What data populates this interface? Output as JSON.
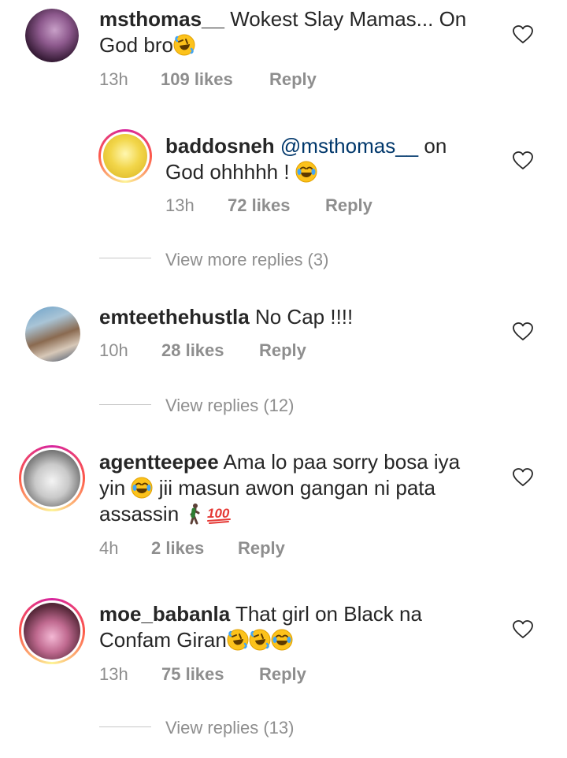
{
  "colors": {
    "text": "#262626",
    "secondary": "#8e8e8e",
    "mention": "#00376b"
  },
  "comments": [
    {
      "username": "msthomas__",
      "text": "Wokest Slay Mamas... On God bro",
      "time": "13h",
      "likes": "109 likes",
      "reply": "Reply",
      "emojis": [
        "rofl-emoji"
      ]
    },
    {
      "username": "baddosneh",
      "mention": "@msthomas__",
      "text_a": " on",
      "text_b": "God ohhhhh ! ",
      "time": "13h",
      "likes": "72 likes",
      "reply": "Reply",
      "emojis": [
        "joy-emoji"
      ]
    },
    {
      "username": "emteethehustla",
      "text": "No Cap !!!!",
      "time": "10h",
      "likes": "28 likes",
      "reply": "Reply"
    },
    {
      "username": "agentteepee",
      "text_a": "Ama lo paa sorry bosa iya",
      "text_b": "yin",
      "text_c": "jii masun awon gangan ni pata",
      "text_d": "assassin",
      "time": "4h",
      "likes": "2 likes",
      "reply": "Reply",
      "emojis": [
        "joy-emoji",
        "walking-man-emoji",
        "hundred-points-emoji"
      ]
    },
    {
      "username": "moe_babanla",
      "text_a": "That girl on Black na",
      "text_b": "Confam Giran",
      "time": "13h",
      "likes": "75 likes",
      "reply": "Reply",
      "emojis": [
        "rofl-emoji",
        "rofl-emoji",
        "joy-emoji"
      ]
    }
  ],
  "view_more": [
    {
      "label": "View more replies (3)"
    },
    {
      "label": "View replies (12)"
    },
    {
      "label": "View replies (13)"
    }
  ]
}
